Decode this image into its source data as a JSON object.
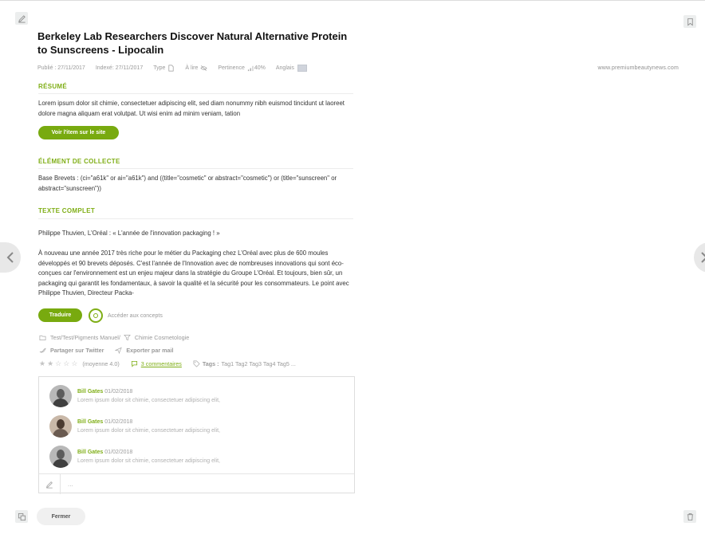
{
  "article": {
    "title": "Berkeley Lab Researchers Discover Natural Alternative Protein to Sunscreens - Lipocalin",
    "published": "Publié : 27/11/2017",
    "indexed": "Indexé: 27/11/2017",
    "type_label": "Type",
    "to_read_label": "À lire",
    "relevance": "Pertinence",
    "relevance_value": "40%",
    "language": "Anglais",
    "source": "www.premiumbeautynews.com"
  },
  "summary": {
    "title": "RÉSUMÉ",
    "text": "Lorem ipsum dolor sit chimie, consectetuer adipiscing elit, sed diam nonummy nibh euismod tincidunt ut laoreet dolore magna aliquam erat volutpat. Ut wisi enim ad minim veniam, tation",
    "view_button": "Voir l'item sur le site"
  },
  "collect": {
    "title": "ÉLÉMENT DE COLLECTE",
    "text": "Base Brevets : (ci=\"a61k\" or ai=\"a61k\") and ((title=\"cosmetic\" or abstract=\"cosmetic\") or (title=\"sunscreen\" or abstract=\"sunscreen\"))"
  },
  "fulltext": {
    "title": "TEXTE COMPLET",
    "line1": "Philippe Thuvien, L'Oréal : « L'année de l'innovation packaging ! »",
    "para": "À nouveau une année 2017 très riche pour le métier du Packaging chez L'Oréal avec plus de 600 moules développés et 90 brevets déposés. C'est l'année de l'Innovation avec de nombreuses innovations qui sont éco-conçues car l'environnement est un enjeu majeur dans la stratégie du Groupe L'Oréal. Et toujours, bien sûr, un packaging qui garantit les fondamentaux, à savoir la qualité et la sécurité pour les consommateurs. Le point avec Philippe Thuvien, Directeur Packa-",
    "translate_button": "Traduire",
    "concepts_link": "Accéder aux concepts"
  },
  "meta_rows": {
    "folders": "Test/Test/Pigments Manuel/",
    "filter": "Chimie Cosmetologie",
    "share": "Partager sur Twitter",
    "export": "Exporter par mail",
    "rating": "(moyenne 4.0)",
    "comments_count": "3 commentaires",
    "tags_label": "Tags :",
    "tags": "Tag1 Tag2 Tag3 Tag4 Tag5 ..."
  },
  "comments": [
    {
      "author": "Bill Gates",
      "date": "01/02/2018",
      "text": "Lorem ipsum dolor sit chimie, consectetuer adipiscing elit,"
    },
    {
      "author": "Bill Gates",
      "date": "01/02/2018",
      "text": "Lorem ipsum dolor sit chimie, consectetuer adipiscing elit,"
    },
    {
      "author": "Bill Gates",
      "date": "01/02/2018",
      "text": "Lorem ipsum dolor sit chimie, consectetuer adipiscing elit,"
    }
  ],
  "comment_input": {
    "placeholder": "..."
  },
  "footer": {
    "close_button": "Fermer"
  },
  "colors": {
    "accent": "#7fae16",
    "button": "#78aa0f"
  }
}
